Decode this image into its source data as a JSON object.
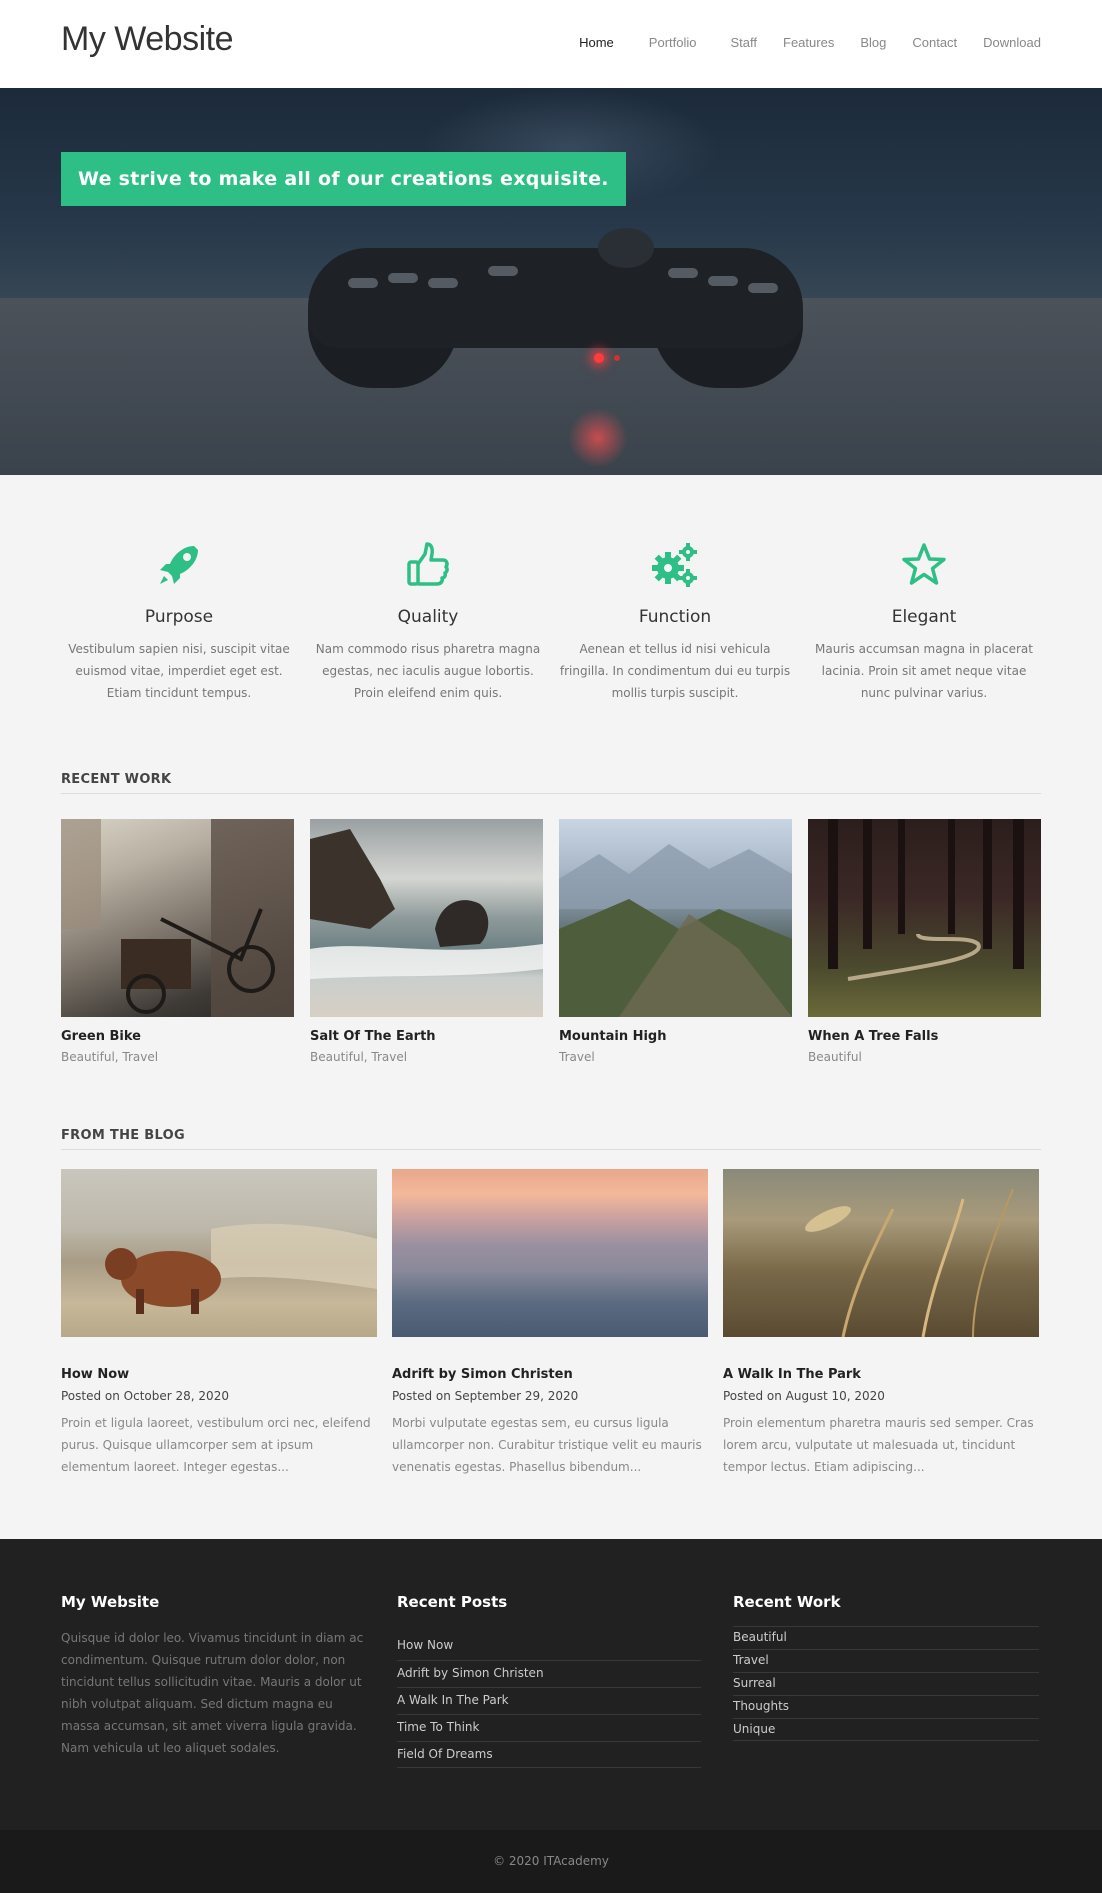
{
  "header": {
    "logo": "My Website",
    "nav": [
      "Home",
      "Portfolio",
      "Staff",
      "Features",
      "Blog",
      "Contact",
      "Download"
    ]
  },
  "hero": {
    "tagline": "We strive to make all of our creations exquisite."
  },
  "features": [
    {
      "icon": "rocket-icon",
      "title": "Purpose",
      "text": "Vestibulum sapien nisi, suscipit vitae euismod vitae, imperdiet eget est. Etiam tincidunt tempus."
    },
    {
      "icon": "thumbs-up-icon",
      "title": "Quality",
      "text": "Nam commodo risus pharetra magna egestas, nec iaculis augue lobortis. Proin eleifend enim quis."
    },
    {
      "icon": "gears-icon",
      "title": "Function",
      "text": "Aenean et tellus id nisi vehicula fringilla. In condimentum dui eu turpis mollis turpis suscipit."
    },
    {
      "icon": "star-icon",
      "title": "Elegant",
      "text": "Mauris accumsan magna in placerat lacinia. Proin sit amet neque vitae nunc pulvinar varius."
    }
  ],
  "recent_work": {
    "heading": "RECENT WORK",
    "items": [
      {
        "title": "Green Bike",
        "categories": "Beautiful, Travel"
      },
      {
        "title": "Salt Of The Earth",
        "categories": "Beautiful, Travel"
      },
      {
        "title": "Mountain High",
        "categories": "Travel"
      },
      {
        "title": "When A Tree Falls",
        "categories": "Beautiful"
      }
    ]
  },
  "blog": {
    "heading": "FROM THE BLOG",
    "posts": [
      {
        "title": "How Now",
        "date": "Posted on October 28, 2020",
        "excerpt": "Proin et ligula laoreet, vestibulum orci nec, eleifend purus. Quisque ullamcorper sem at ipsum elementum laoreet. Integer egestas..."
      },
      {
        "title": "Adrift by Simon Christen",
        "date": "Posted on September 29, 2020",
        "excerpt": "Morbi vulputate egestas sem, eu cursus ligula ullamcorper non. Curabitur tristique velit eu mauris venenatis egestas. Phasellus bibendum..."
      },
      {
        "title": "A Walk In The Park",
        "date": "Posted on August 10, 2020",
        "excerpt": "Proin elementum pharetra mauris sed semper. Cras lorem arcu, vulputate ut malesuada ut, tincidunt tempor lectus. Etiam adipiscing..."
      }
    ]
  },
  "footer": {
    "about": {
      "heading": "My Website",
      "text": "Quisque id dolor leo. Vivamus tincidunt in diam ac condimentum. Quisque rutrum dolor dolor, non tincidunt tellus sollicitudin vitae. Mauris a dolor ut nibh volutpat aliquam. Sed dictum magna eu massa accumsan, sit amet viverra ligula gravida. Nam vehicula ut leo aliquet sodales."
    },
    "recent_posts": {
      "heading": "Recent Posts",
      "items": [
        "How Now",
        "Adrift by Simon Christen",
        "A Walk In The Park",
        "Time To Think",
        "Field Of Dreams"
      ]
    },
    "recent_work": {
      "heading": "Recent Work",
      "items": [
        "Beautiful",
        "Travel",
        "Surreal",
        "Thoughts",
        "Unique"
      ]
    },
    "copyright": "© 2020 ITAcademy"
  },
  "colors": {
    "accent": "#2ebf86",
    "footer_bg": "#212121",
    "bottom_bg": "#1a1a1a"
  }
}
